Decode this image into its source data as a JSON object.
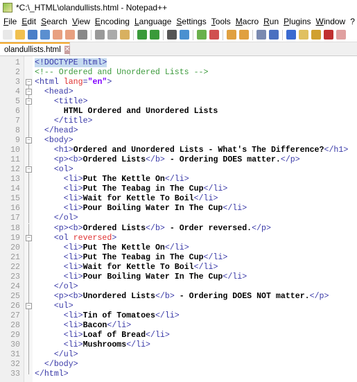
{
  "window": {
    "title": "*C:\\_HTML\\olandullists.html - Notepad++"
  },
  "menu": [
    "File",
    "Edit",
    "Search",
    "View",
    "Encoding",
    "Language",
    "Settings",
    "Tools",
    "Macro",
    "Run",
    "Plugins",
    "Window",
    "?"
  ],
  "toolbar_icons": [
    "new-file",
    "open-file",
    "save",
    "save-all",
    "close",
    "close-all",
    "print",
    "cut",
    "copy",
    "paste",
    "undo",
    "redo",
    "find",
    "replace",
    "zoom-in",
    "zoom-out",
    "sync-v",
    "sync-h",
    "word-wrap",
    "show-all-chars",
    "indent-guide",
    "udl",
    "doc-map",
    "function-list",
    "folder"
  ],
  "tab": {
    "label": "olandullists.html",
    "status": "unsaved"
  },
  "colors": {
    "tag": "#3a3aa8",
    "attr": "#e03030",
    "value": "#8000ff",
    "comment": "#3c9a3c",
    "tab_accent": "#f5a623"
  },
  "lines": [
    [
      [
        "tag hl",
        "<!"
      ],
      [
        "tag hl",
        "DOCTYPE html"
      ],
      [
        "tag hl",
        ">"
      ]
    ],
    [
      [
        "cmt",
        "<!-- Ordered and Unordered Lists -->"
      ]
    ],
    [
      [
        "tag",
        "<html "
      ],
      [
        "attr",
        "lang"
      ],
      [
        "tag",
        "="
      ],
      [
        "val",
        "\"en\""
      ],
      [
        "tag",
        ">"
      ]
    ],
    [
      [
        "",
        "  "
      ],
      [
        "tag",
        "<head>"
      ]
    ],
    [
      [
        "",
        "    "
      ],
      [
        "tag",
        "<title>"
      ]
    ],
    [
      [
        "",
        "      "
      ],
      [
        "txt",
        "HTML Ordered and Unordered Lists"
      ]
    ],
    [
      [
        "",
        "    "
      ],
      [
        "tag",
        "</title>"
      ]
    ],
    [
      [
        "",
        "  "
      ],
      [
        "tag",
        "</head>"
      ]
    ],
    [
      [
        "",
        "  "
      ],
      [
        "tag",
        "<body>"
      ]
    ],
    [
      [
        "",
        "    "
      ],
      [
        "tag",
        "<h1>"
      ],
      [
        "txt",
        "Ordered and Unordered Lists - What's The Difference?"
      ],
      [
        "tag",
        "</h1>"
      ]
    ],
    [
      [
        "",
        "    "
      ],
      [
        "tag",
        "<p><b>"
      ],
      [
        "txt",
        "Ordered Lists"
      ],
      [
        "tag",
        "</b>"
      ],
      [
        "txt",
        " - Ordering DOES matter."
      ],
      [
        "tag",
        "</p>"
      ]
    ],
    [
      [
        "",
        "    "
      ],
      [
        "tag",
        "<ol>"
      ]
    ],
    [
      [
        "",
        "      "
      ],
      [
        "tag",
        "<li>"
      ],
      [
        "txt",
        "Put The Kettle On"
      ],
      [
        "tag",
        "</li>"
      ]
    ],
    [
      [
        "",
        "      "
      ],
      [
        "tag",
        "<li>"
      ],
      [
        "txt",
        "Put The Teabag in The Cup"
      ],
      [
        "tag",
        "</li>"
      ]
    ],
    [
      [
        "",
        "      "
      ],
      [
        "tag",
        "<li>"
      ],
      [
        "txt",
        "Wait for Kettle To Boil"
      ],
      [
        "tag",
        "</li>"
      ]
    ],
    [
      [
        "",
        "      "
      ],
      [
        "tag",
        "<li>"
      ],
      [
        "txt",
        "Pour Boiling Water In The Cup"
      ],
      [
        "tag",
        "</li>"
      ]
    ],
    [
      [
        "",
        "    "
      ],
      [
        "tag",
        "</ol>"
      ]
    ],
    [
      [
        "",
        "    "
      ],
      [
        "tag",
        "<p><b>"
      ],
      [
        "txt",
        "Ordered Lists"
      ],
      [
        "tag",
        "</b>"
      ],
      [
        "txt",
        " - Order reversed."
      ],
      [
        "tag",
        "</p>"
      ]
    ],
    [
      [
        "",
        "    "
      ],
      [
        "tag",
        "<ol "
      ],
      [
        "attr",
        "reversed"
      ],
      [
        "tag",
        ">"
      ]
    ],
    [
      [
        "",
        "      "
      ],
      [
        "tag",
        "<li>"
      ],
      [
        "txt",
        "Put The Kettle On"
      ],
      [
        "tag",
        "</li>"
      ]
    ],
    [
      [
        "",
        "      "
      ],
      [
        "tag",
        "<li>"
      ],
      [
        "txt",
        "Put The Teabag in The Cup"
      ],
      [
        "tag",
        "</li>"
      ]
    ],
    [
      [
        "",
        "      "
      ],
      [
        "tag",
        "<li>"
      ],
      [
        "txt",
        "Wait for Kettle To Boil"
      ],
      [
        "tag",
        "</li>"
      ]
    ],
    [
      [
        "",
        "      "
      ],
      [
        "tag",
        "<li>"
      ],
      [
        "txt",
        "Pour Boiling Water In The Cup"
      ],
      [
        "tag",
        "</li>"
      ]
    ],
    [
      [
        "",
        "    "
      ],
      [
        "tag",
        "</ol>"
      ]
    ],
    [
      [
        "",
        "    "
      ],
      [
        "tag",
        "<p><b>"
      ],
      [
        "txt",
        "Unordered Lists"
      ],
      [
        "tag",
        "</b>"
      ],
      [
        "txt",
        " - Ordering DOES NOT matter."
      ],
      [
        "tag",
        "</p>"
      ]
    ],
    [
      [
        "",
        "    "
      ],
      [
        "tag",
        "<ul>"
      ]
    ],
    [
      [
        "",
        "      "
      ],
      [
        "tag",
        "<li>"
      ],
      [
        "txt",
        "Tin of Tomatoes"
      ],
      [
        "tag",
        "</li>"
      ]
    ],
    [
      [
        "",
        "      "
      ],
      [
        "tag",
        "<li>"
      ],
      [
        "txt",
        "Bacon"
      ],
      [
        "tag",
        "</li>"
      ]
    ],
    [
      [
        "",
        "      "
      ],
      [
        "tag",
        "<li>"
      ],
      [
        "txt",
        "Loaf of Bread"
      ],
      [
        "tag",
        "</li>"
      ]
    ],
    [
      [
        "",
        "      "
      ],
      [
        "tag",
        "<li>"
      ],
      [
        "txt",
        "Mushrooms"
      ],
      [
        "tag",
        "</li>"
      ]
    ],
    [
      [
        "",
        "    "
      ],
      [
        "tag",
        "</ul>"
      ]
    ],
    [
      [
        "",
        "  "
      ],
      [
        "tag",
        "</body>"
      ]
    ],
    [
      [
        "tag",
        "</html>"
      ]
    ]
  ]
}
